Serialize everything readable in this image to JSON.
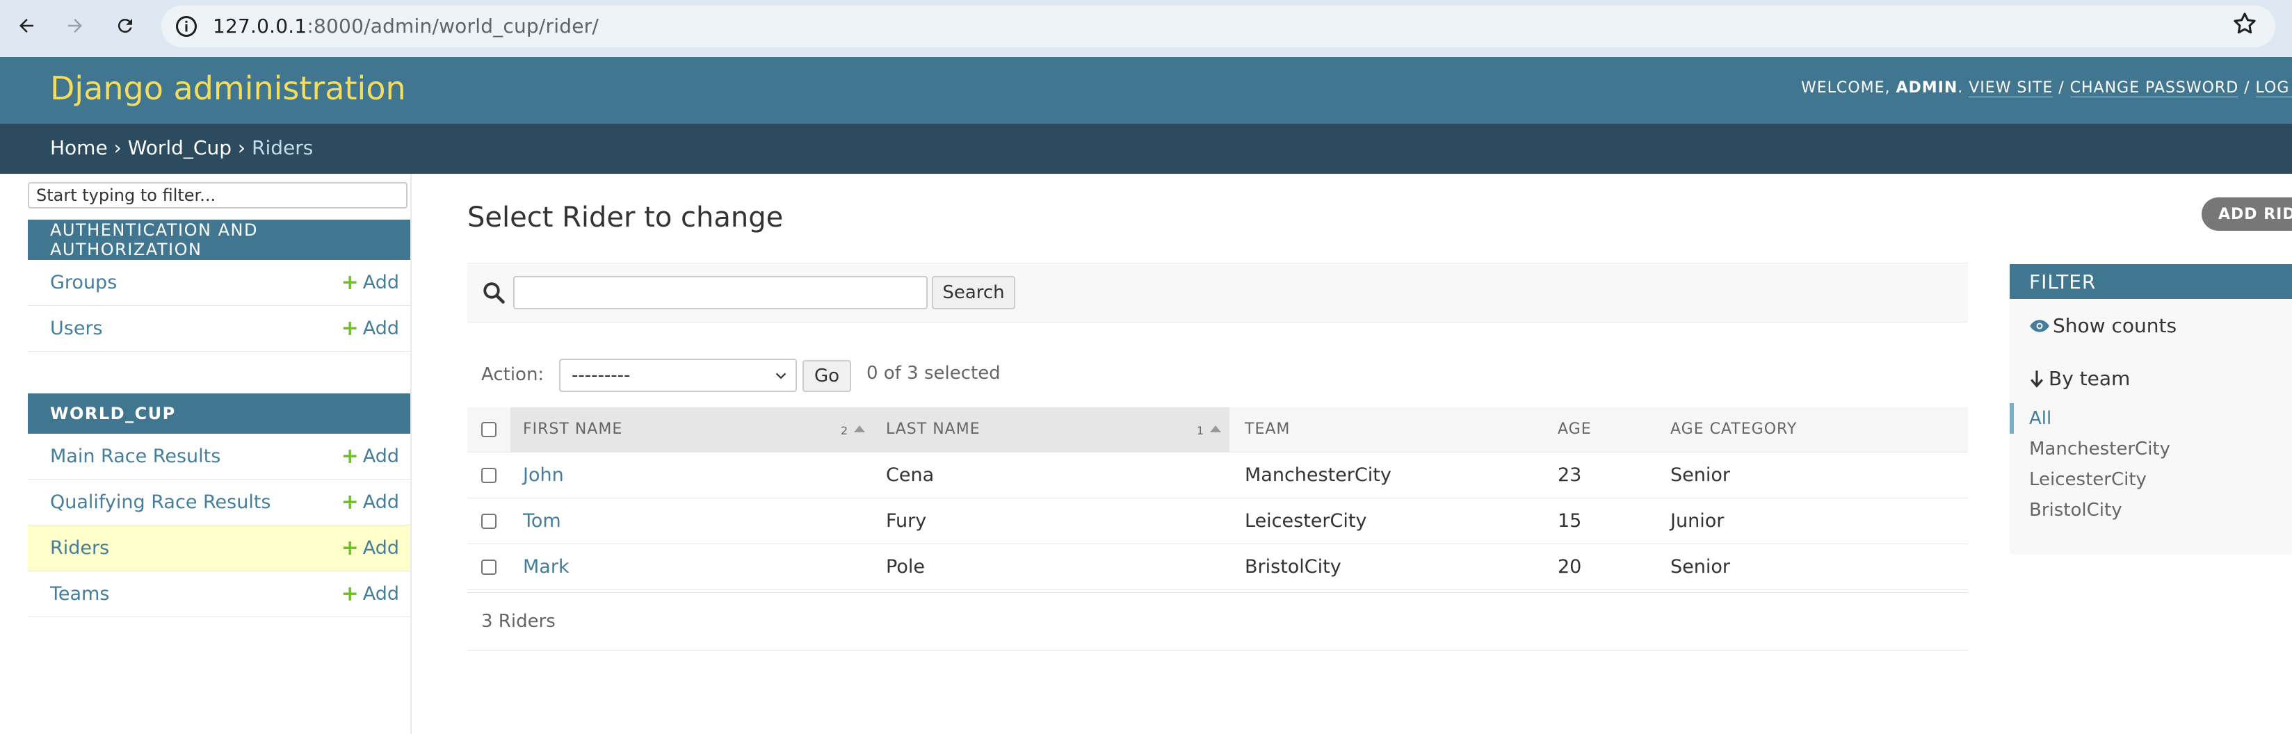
{
  "browser": {
    "url_host": "127.0.0.1",
    "url_path": ":8000/admin/world_cup/rider/"
  },
  "header": {
    "branding": "Django administration",
    "welcome": "WELCOME,",
    "username": "ADMIN",
    "view_site": "VIEW SITE",
    "change_password": "CHANGE PASSWORD",
    "log_out": "LOG OUT",
    "separator": " / "
  },
  "breadcrumbs": {
    "home": "Home",
    "app": "World_Cup",
    "current": "Riders",
    "sep": " › "
  },
  "sidebar": {
    "filter_placeholder": "Start typing to filter...",
    "add_label": "Add",
    "modules": [
      {
        "caption": "Authentication and Authorization",
        "models": [
          {
            "name": "Groups"
          },
          {
            "name": "Users"
          }
        ]
      },
      {
        "caption": "World_Cup",
        "models": [
          {
            "name": "Main Race Results"
          },
          {
            "name": "Qualifying Race Results"
          },
          {
            "name": "Riders"
          },
          {
            "name": "Teams"
          }
        ]
      }
    ]
  },
  "content": {
    "title": "Select Rider to change",
    "add_button": "ADD RIDER",
    "search_button": "Search",
    "action_label": "Action:",
    "action_selected": "---------",
    "go_button": "Go",
    "selection_counter": "0 of 3 selected",
    "columns": [
      {
        "label": "First name",
        "sort_priority": "2"
      },
      {
        "label": "Last name",
        "sort_priority": "1"
      },
      {
        "label": "Team",
        "sort_priority": ""
      },
      {
        "label": "Age",
        "sort_priority": ""
      },
      {
        "label": "Age category",
        "sort_priority": ""
      }
    ],
    "rows": [
      {
        "first": "John",
        "last": "Cena",
        "team": "ManchesterCity",
        "age": "23",
        "category": "Senior"
      },
      {
        "first": "Tom",
        "last": "Fury",
        "team": "LeicesterCity",
        "age": "15",
        "category": "Junior"
      },
      {
        "first": "Mark",
        "last": "Pole",
        "team": "BristolCity",
        "age": "20",
        "category": "Senior"
      }
    ],
    "paginator": "3 Riders"
  },
  "filter": {
    "title": "Filter",
    "show_counts": "Show counts",
    "by_team": "By team",
    "options": [
      "All",
      "ManchesterCity",
      "LeicesterCity",
      "BristolCity"
    ]
  },
  "colors": {
    "header_bg": "#417690",
    "breadcrumb_bg": "#2c4b5e",
    "branding": "#f5dd5d",
    "link": "#447e9b",
    "add_plus": "#70bf2b",
    "current_row": "#ffffcc"
  }
}
